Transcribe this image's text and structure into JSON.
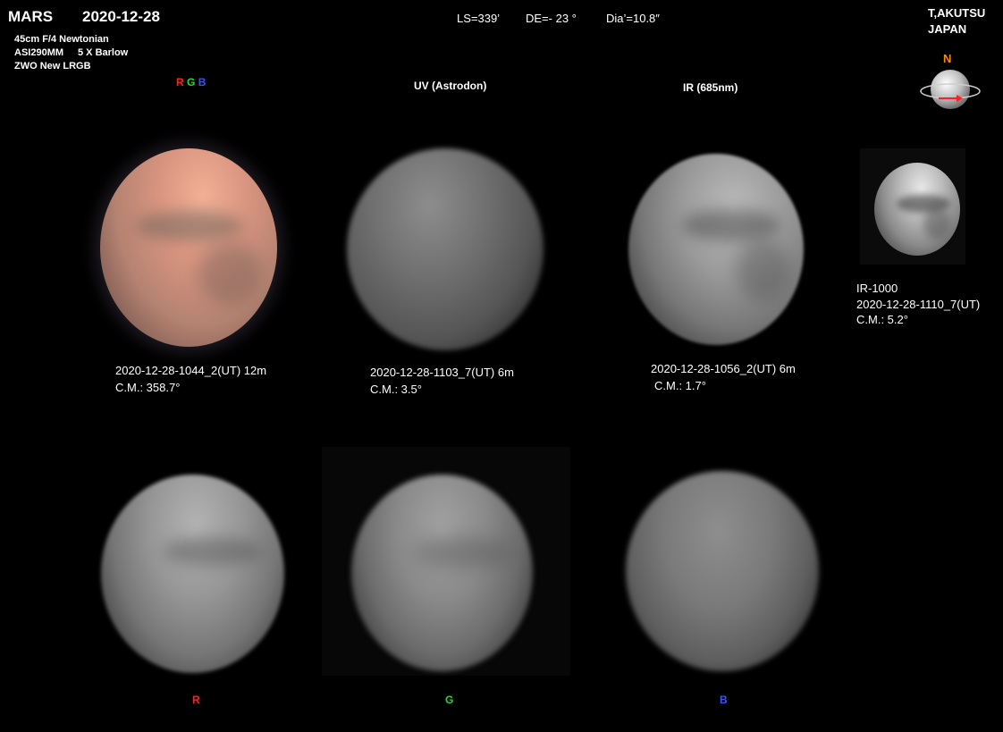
{
  "header": {
    "object": "MARS",
    "date": "2020-12-28",
    "ls": "LS=339’",
    "de": "DE=-  23 °",
    "dia": "Dia’=10.8″",
    "observer": "T,AKUTSU",
    "country": "JAPAN"
  },
  "equipment": {
    "telescope": "45cm F/4  Newtonian",
    "camera": "ASI290MM",
    "barlow": "5 X  Barlow",
    "filters": "ZWO  New LRGB"
  },
  "compass": {
    "north": "N",
    "icon": "rotation-globe-icon"
  },
  "rgb_header": {
    "r": "R",
    "g": "G",
    "b": "B"
  },
  "uv_header": "UV  (Astrodon)",
  "ir_header": "IR (685nm)",
  "rgb_info": {
    "time": "2020-12-28-1044_2(UT)  12m",
    "cm": "C.M.:   358.7°"
  },
  "uv_info": {
    "time": "2020-12-28-1103_7(UT)   6m",
    "cm": "C.M.:     3.5°"
  },
  "ir_info": {
    "time": "2020-12-28-1056_2(UT)   6m",
    "cm": "C.M.:     1.7°"
  },
  "ir1000_info": {
    "label": "IR-1000",
    "time": "2020-12-28-1110_7(UT)",
    "cm": "C.M.:     5.2°"
  },
  "channel_labels": {
    "r": "R",
    "g": "G",
    "b": "B"
  },
  "colors": {
    "red": "#ff2222",
    "green": "#22dd22",
    "blue": "#3355ff",
    "north": "#ff8800"
  }
}
